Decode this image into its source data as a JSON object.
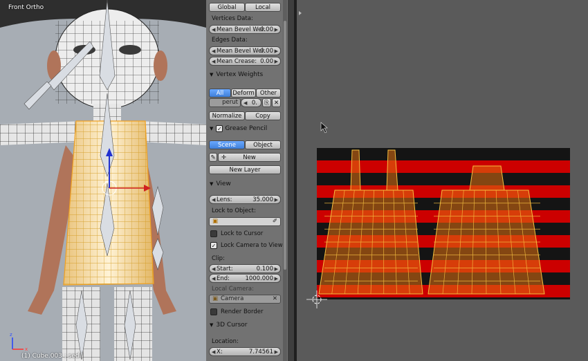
{
  "viewport": {
    "view_label": "Front Ortho",
    "object_label": "(1) Cube.003 : sedil"
  },
  "props": {
    "mode_tabs": [
      "Global",
      "Local"
    ],
    "vertices_data": {
      "label": "Vertices Data:",
      "field_name": "Mean Bevel Wei:",
      "field_value": "0.00"
    },
    "edges_data": {
      "label": "Edges Data:",
      "bevel_name": "Mean Bevel Wei:",
      "bevel_value": "0.00",
      "crease_name": "Mean Crease:",
      "crease_value": "0.00"
    },
    "vertex_weights": {
      "title": "Vertex Weights",
      "tabs": [
        "All",
        "Deform",
        "Other"
      ],
      "group_name": "perut",
      "group_value": "0.",
      "normalize_label": "Normalize",
      "copy_label": "Copy"
    },
    "grease_pencil": {
      "title": "Grease Pencil",
      "tabs": [
        "Scene",
        "Object"
      ],
      "new_label": "New",
      "new_layer_label": "New Layer"
    },
    "view": {
      "title": "View",
      "lens_name": "Lens:",
      "lens_value": "35.000",
      "lock_object_label": "Lock to Object:",
      "lock_cursor_label": "Lock to Cursor",
      "lock_camera_label": "Lock Camera to View",
      "clip_label": "Clip:",
      "start_name": "Start:",
      "start_value": "0.100",
      "end_name": "End:",
      "end_value": "1000.000",
      "local_camera_label": "Local Camera:",
      "camera_field": "Camera",
      "render_border_label": "Render Border"
    },
    "cursor_3d": {
      "title": "3D Cursor",
      "location_label": "Location:",
      "x_name": "X:",
      "x_value": "7.74561"
    }
  },
  "colors": {
    "selected_tab": "#5596f0",
    "mesh_select": "#f0a020",
    "stripe_red": "#cc0000"
  }
}
